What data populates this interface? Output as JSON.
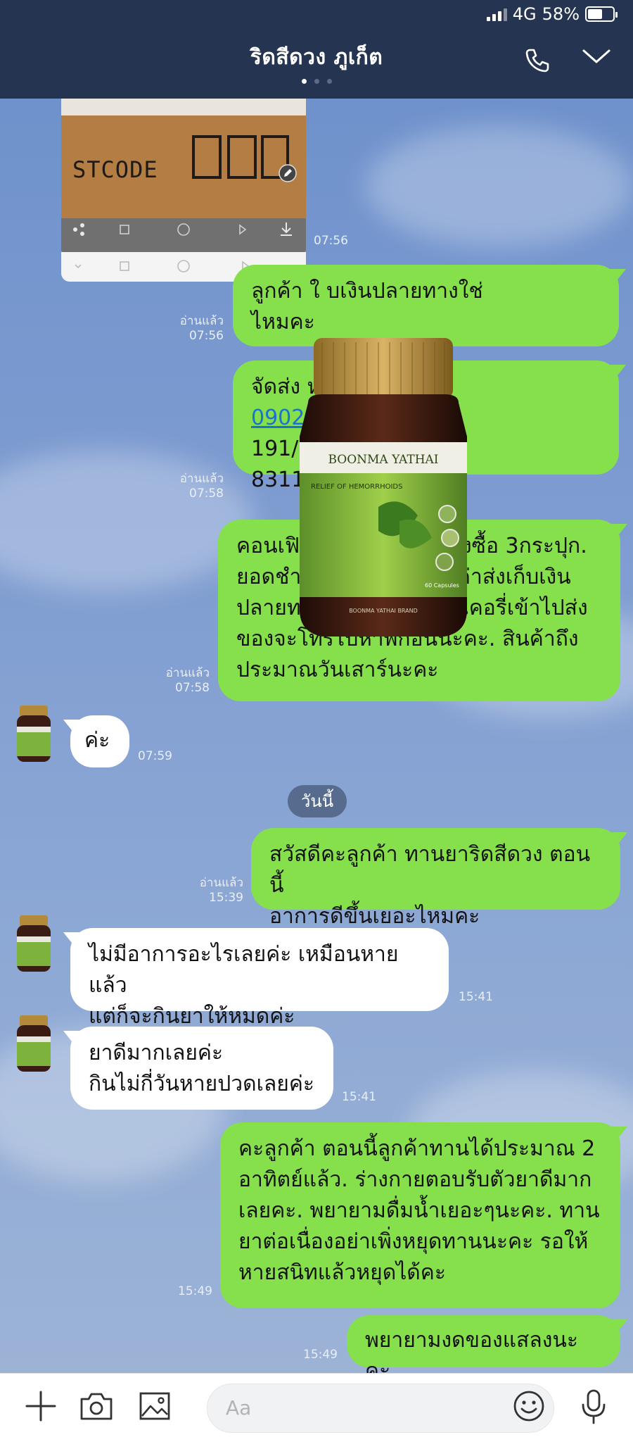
{
  "status": {
    "network": "4G",
    "battery": "58%",
    "battery_level": 0.58
  },
  "header": {
    "title": "ริดสีดวง ภูเก็ต",
    "page_dots": 3,
    "active_dot": 0,
    "call_icon": "phone-icon",
    "menu_icon": "chevron-down-icon"
  },
  "image_message": {
    "label": "STCODE",
    "time": "07:56"
  },
  "messages": [
    {
      "dir": "out",
      "text": "ลูกค้า ใ                    บเงินปลายทางใช่\nไหมคะ",
      "read": "อ่านแล้ว",
      "time": "07:56"
    },
    {
      "dir": "out",
      "text_1": "จัดส่ง                              หม่.",
      "link": "0902",
      "text_2": "191/2                           ถลาง จ ภูเก็ต.\n8311",
      "read": "อ่านแล้ว",
      "time": "07:58"
    },
    {
      "dir": "out",
      "text": "คอนเฟิมออเดอรนะคะ. สั่งซื้อ 3กระปุก.\nยอดชำระ 1000บาท ฟรีค่าส่งเก็บเงิน\nปลายทาง.    ก่อนเจ้าหน้าที่เคอรี่เข้าไปส่ง\nของจะโทรไปหาพี่ก่อนนะคะ.  สินค้าถึง\nประมาณวันเสาร์นะคะ",
      "read": "อ่านแล้ว",
      "time": "07:58"
    },
    {
      "dir": "in",
      "text": "ค่ะ",
      "time": "07:59"
    },
    {
      "dir": "out",
      "text": "สวัสดีคะลูกค้า ทานยาริดสีดวง ตอนนี้\nอาการดีขึ้นเยอะไหมคะ",
      "read": "อ่านแล้ว",
      "time": "15:39"
    },
    {
      "dir": "in",
      "text": "ไม่มีอาการอะไรเลยค่ะ เหมือนหายแล้ว\nแต่ก็จะกินยาให้หมดค่ะ",
      "time": "15:41"
    },
    {
      "dir": "in",
      "text": "ยาดีมากเลยค่ะ\nกินไม่กี่วันหายปวดเลยค่ะ",
      "time": "15:41"
    },
    {
      "dir": "out",
      "text": "คะลูกค้า ตอนนี้ลูกค้าทานได้ประมาณ 2\nอาทิตย์แล้ว.  ร่างกายตอบรับตัวยาดีมาก\nเลยคะ. พยายามดื่มน้ำเยอะๆนะคะ. ทาน\nยาต่อเนื่องอย่าเพิ่งหยุดทานนะคะ รอให้\nหายสนิทแล้วหยุดได้คะ",
      "time": "15:49"
    },
    {
      "dir": "out",
      "text": "พยายามงดของแสลงนะคะ",
      "time": "15:49"
    }
  ],
  "date_divider": "วันนี้",
  "product": {
    "brand": "BOONMA YATHAI",
    "label": "RELIEF OF HEMORRHOIDS",
    "footer": "BOONMA YATHAI BRAND",
    "count": "60 Capsules"
  },
  "input": {
    "placeholder": "Aa"
  },
  "bottom_icons": [
    "plus-icon",
    "camera-icon",
    "image-icon",
    "smile-icon",
    "microphone-icon"
  ],
  "colors": {
    "header": "#253450",
    "outgoing": "#86e04c",
    "incoming": "#ffffff",
    "link": "#1a73d1"
  }
}
